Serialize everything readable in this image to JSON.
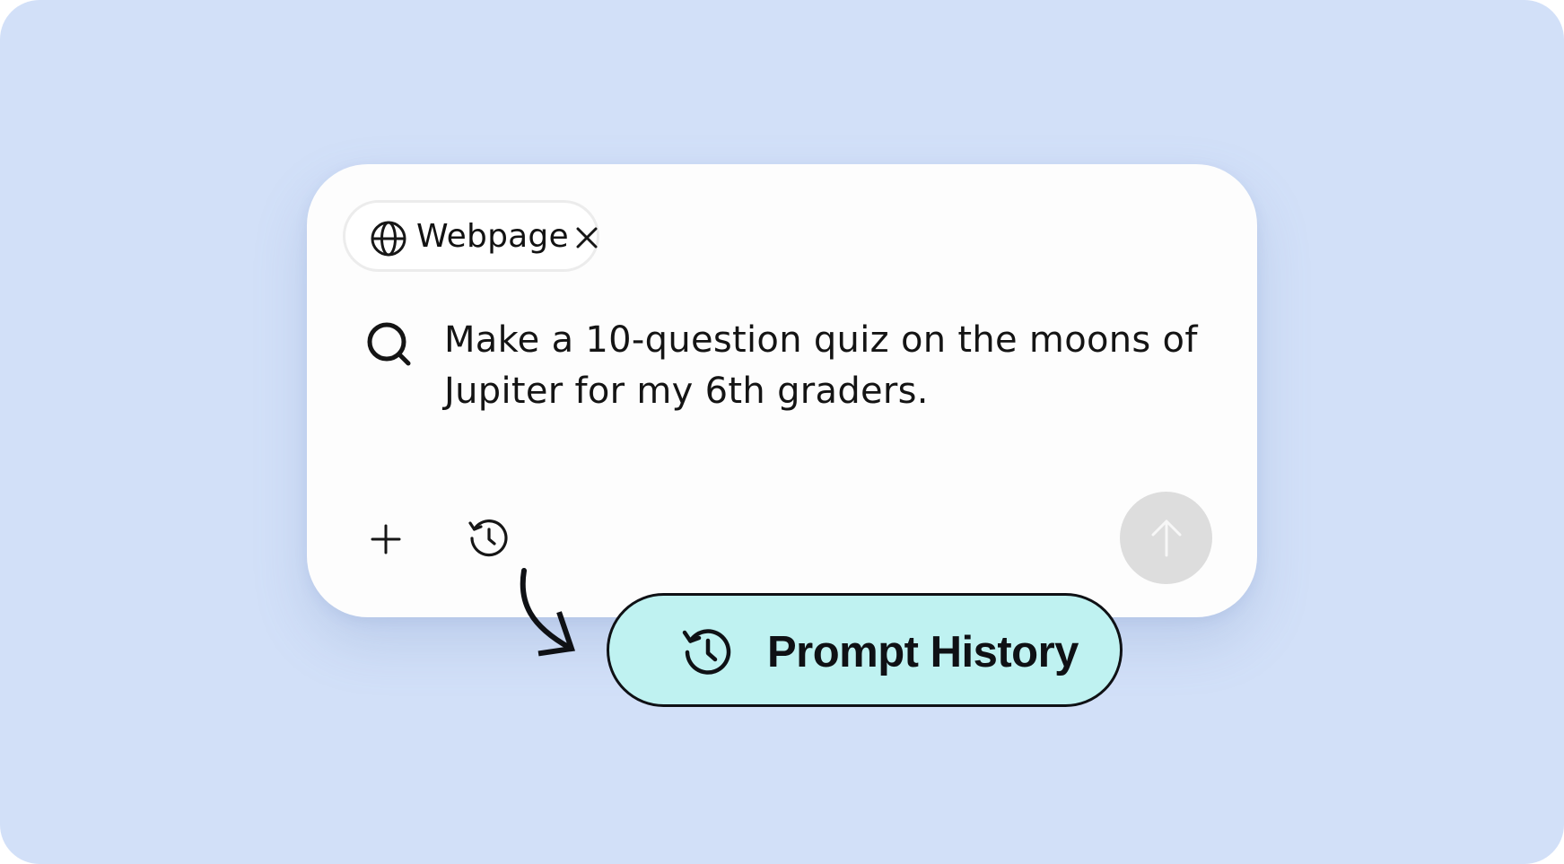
{
  "chip": {
    "label": "Webpage",
    "icon": "globe-icon",
    "close_icon": "close-icon"
  },
  "prompt": {
    "text": "Make a 10-question quiz on the moons of Jupiter for my 6th graders.",
    "icon": "search-icon"
  },
  "toolbar": {
    "add_icon": "plus-icon",
    "history_icon": "history-icon",
    "send_icon": "arrow-up-icon"
  },
  "callout": {
    "label": "Prompt History",
    "icon": "history-icon"
  },
  "colors": {
    "background": "#d2e0f8",
    "card": "#fdfdfd",
    "callout_fill": "#bff2f1",
    "send_button": "#dddddd",
    "text": "#141414"
  }
}
